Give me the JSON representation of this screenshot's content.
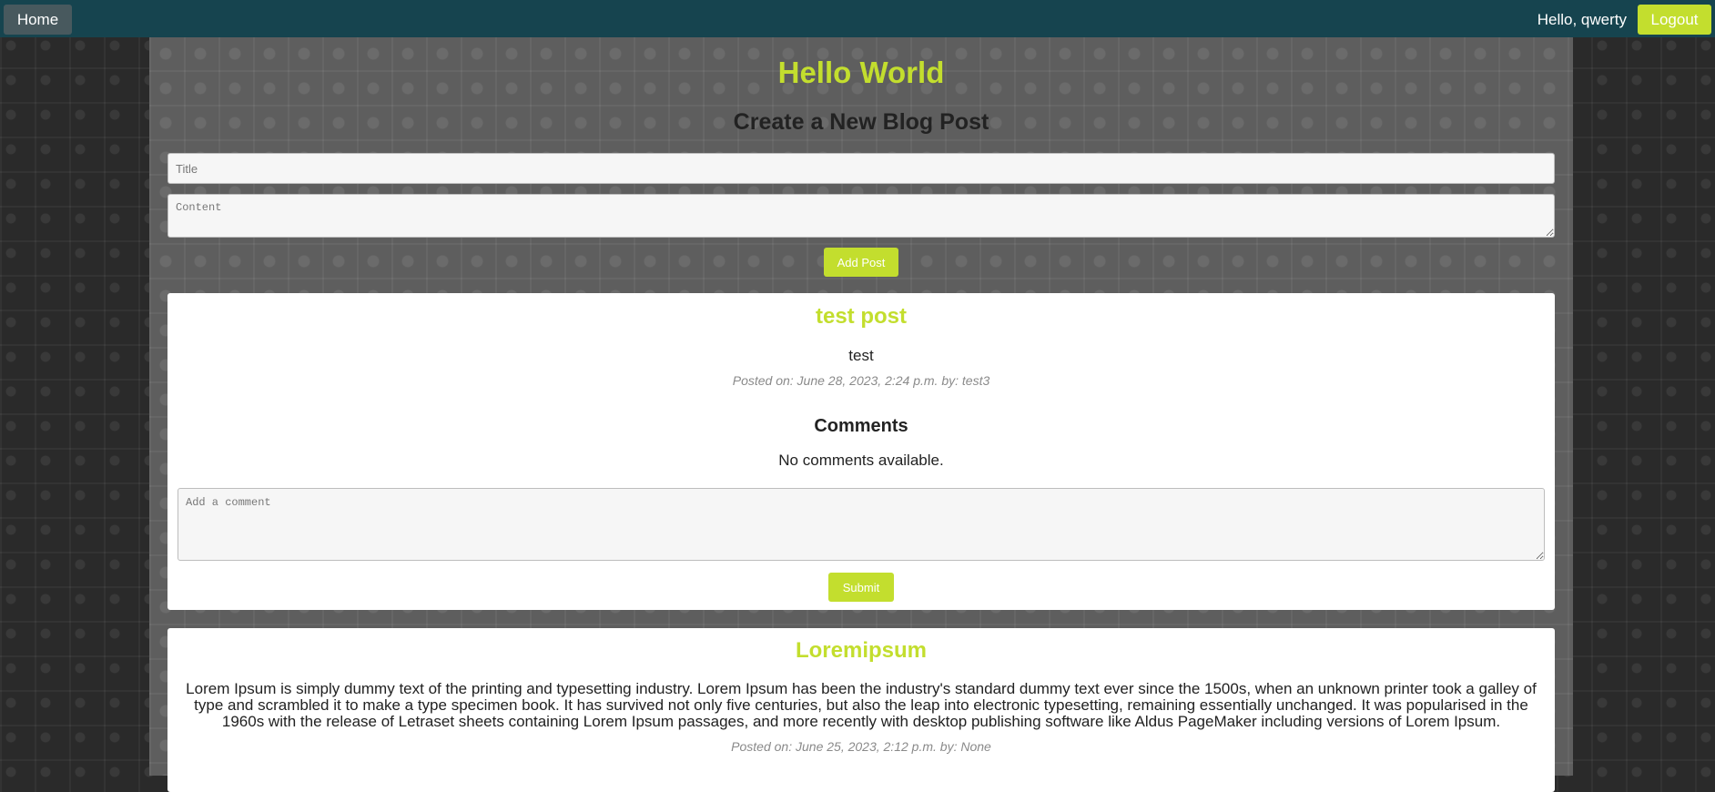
{
  "nav": {
    "home_label": "Home",
    "greeting": "Hello, qwerty",
    "logout_label": "Logout"
  },
  "page": {
    "site_title": "Hello World",
    "form_heading": "Create a New Blog Post",
    "title_placeholder": "Title",
    "content_placeholder": "Content",
    "add_post_label": "Add Post"
  },
  "posts": [
    {
      "title": "test post",
      "content": "test",
      "meta": "Posted on: June 28, 2023, 2:24 p.m. by: test3",
      "comments_heading": "Comments",
      "no_comments": "No comments available.",
      "comment_placeholder": "Add a comment",
      "submit_label": "Submit"
    },
    {
      "title": "Loremipsum",
      "content": "Lorem Ipsum is simply dummy text of the printing and typesetting industry. Lorem Ipsum has been the industry's standard dummy text ever since the 1500s, when an unknown printer took a galley of type and scrambled it to make a type specimen book. It has survived not only five centuries, but also the leap into electronic typesetting, remaining essentially unchanged. It was popularised in the 1960s with the release of Letraset sheets containing Lorem Ipsum passages, and more recently with desktop publishing software like Aldus PageMaker including versions of Lorem Ipsum.",
      "meta": "Posted on: June 25, 2023, 2:12 p.m. by: None"
    }
  ],
  "colors": {
    "accent": "#c3de2e",
    "navbar": "#16444f",
    "home_button": "#48595e"
  }
}
